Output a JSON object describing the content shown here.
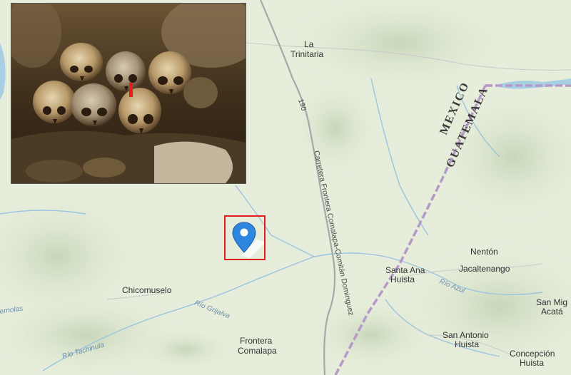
{
  "map": {
    "places": [
      {
        "id": "la-trinitaria",
        "lines": [
          "La",
          "Trinitaria"
        ]
      },
      {
        "id": "chicomuselo",
        "lines": [
          "Chicomuselo"
        ]
      },
      {
        "id": "frontera-comalapa",
        "lines": [
          "Frontera",
          "Comalapa"
        ]
      },
      {
        "id": "santa-ana-huista",
        "lines": [
          "Santa Ana",
          "Huista"
        ]
      },
      {
        "id": "nenton",
        "lines": [
          "Nentón"
        ]
      },
      {
        "id": "jacaltenango",
        "lines": [
          "Jacaltenango"
        ]
      },
      {
        "id": "san-antonio-huista",
        "lines": [
          "San Antonio",
          "Huista"
        ]
      },
      {
        "id": "concepcion-huista",
        "lines": [
          "Concepción",
          "Huista"
        ]
      },
      {
        "id": "san-miguel-acatan",
        "lines": [
          "San Mig",
          "Acatá"
        ]
      }
    ],
    "road_number": "190",
    "road_name": "Carretera Frontera Comalapa-Comitán Dominguez",
    "rivers": {
      "grijalva": "Río Grijalva",
      "tachinula": "Río Tachinula",
      "azul": "Río Azul",
      "edge": "ernolas"
    },
    "countries": {
      "north": "MEXICO",
      "south": "GUATEMALA"
    },
    "colors": {
      "land": "#e4ecd8",
      "border": "#b59ac7",
      "highlight": "#e31e1e",
      "pin": "#2e86de"
    }
  },
  "photo": {
    "subject": "skulls-in-cave"
  },
  "marker": {
    "icon": "location-pin-icon"
  }
}
